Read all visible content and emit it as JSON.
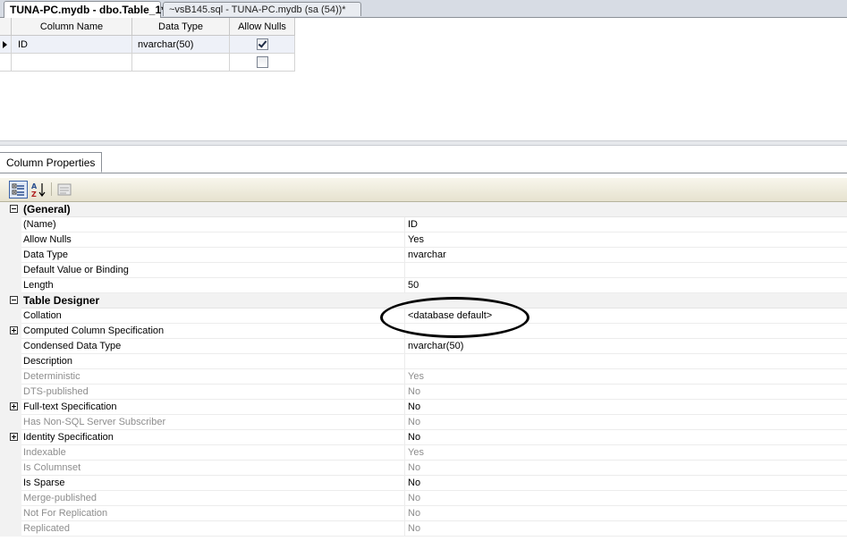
{
  "tabs": [
    {
      "label": "TUNA-PC.mydb - dbo.Table_1*",
      "active": true
    },
    {
      "label": "~vsB145.sql - TUNA-PC.mydb (sa (54))*",
      "active": false
    }
  ],
  "grid": {
    "headers": [
      "Column Name",
      "Data Type",
      "Allow Nulls"
    ],
    "rows": [
      {
        "name": "ID",
        "type": "nvarchar(50)",
        "allow_nulls": true
      },
      {
        "name": "",
        "type": "",
        "allow_nulls": false
      }
    ]
  },
  "column_properties": {
    "tab_label": "Column Properties",
    "toolbar_icons": [
      "categorized-icon",
      "alphabetical-icon",
      "property-pages-icon"
    ],
    "rows": [
      {
        "kind": "category",
        "label": "(General)",
        "value": ""
      },
      {
        "kind": "prop",
        "label": "(Name)",
        "value": "ID"
      },
      {
        "kind": "prop",
        "label": "Allow Nulls",
        "value": "Yes"
      },
      {
        "kind": "prop",
        "label": "Data Type",
        "value": "nvarchar"
      },
      {
        "kind": "prop",
        "label": "Default Value or Binding",
        "value": ""
      },
      {
        "kind": "prop",
        "label": "Length",
        "value": "50"
      },
      {
        "kind": "category",
        "label": "Table Designer",
        "value": ""
      },
      {
        "kind": "prop",
        "label": "Collation",
        "value": "<database default>"
      },
      {
        "kind": "expand",
        "label": "Computed Column Specification",
        "value": ""
      },
      {
        "kind": "prop",
        "label": "Condensed Data Type",
        "value": "nvarchar(50)"
      },
      {
        "kind": "prop",
        "label": "Description",
        "value": ""
      },
      {
        "kind": "disabled",
        "label": "Deterministic",
        "value": "Yes"
      },
      {
        "kind": "disabled",
        "label": "DTS-published",
        "value": "No"
      },
      {
        "kind": "expand",
        "label": "Full-text Specification",
        "value": "No"
      },
      {
        "kind": "disabled",
        "label": "Has Non-SQL Server Subscriber",
        "value": "No"
      },
      {
        "kind": "expand",
        "label": "Identity Specification",
        "value": "No"
      },
      {
        "kind": "disabled",
        "label": "Indexable",
        "value": "Yes"
      },
      {
        "kind": "disabled",
        "label": "Is Columnset",
        "value": "No"
      },
      {
        "kind": "prop",
        "label": "Is Sparse",
        "value": "No"
      },
      {
        "kind": "disabled",
        "label": "Merge-published",
        "value": "No"
      },
      {
        "kind": "disabled",
        "label": "Not For Replication",
        "value": "No"
      },
      {
        "kind": "disabled",
        "label": "Replicated",
        "value": "No"
      }
    ]
  }
}
